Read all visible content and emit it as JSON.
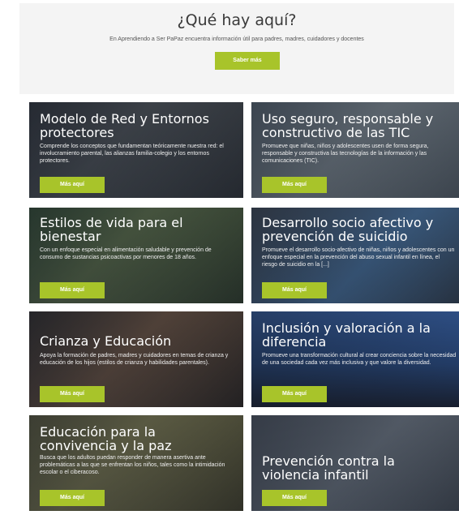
{
  "header": {
    "title": "¿Qué hay aquí?",
    "subtitle": "En Aprendiendo a Ser PaPaz encuentra información útil para padres, madres, cuidadores y docentes",
    "cta_label": "Saber más"
  },
  "cards": [
    {
      "title": "Modelo de Red y Entornos protectores",
      "description": "Comprende los conceptos que fundamentan teóricamente nuestra red: el involucramiento parental, las alianzas familia-colegio y los entornos protectores.",
      "button": "Más aquí"
    },
    {
      "title": "Uso seguro, responsable y constructivo de las TIC",
      "description": "Promueve que niñas, niños y adolescentes usen de forma segura, responsable y constructiva las tecnologías de la información y las comunicaciones (TIC).",
      "button": "Más aquí"
    },
    {
      "title": "Estilos de vida para el bienestar",
      "description": "Con un enfoque especial en alimentación saludable y prevención de consumo de sustancias psicoactivas por menores de 18 años.",
      "button": "Más aquí"
    },
    {
      "title": "Desarrollo socio afectivo y prevención de suicidio",
      "description": "Promueve el desarrollo socio-afectivo de niñas, niños y adolescentes con un enfoque especial en la prevención del abuso sexual infantil en línea, el riesgo de suicidio en la [...]",
      "button": "Más aquí"
    },
    {
      "title": "Crianza y Educación",
      "description": "Apoya la formación de padres, madres y cuidadores en temas de crianza y educación de los hijos (estilos de crianza y habilidades parentales).",
      "button": "Más aquí"
    },
    {
      "title": "Inclusión y valoración a la diferencia",
      "description": "Promueve una transformación cultural al crear conciencia sobre la necesidad de una sociedad cada vez más inclusiva y que valore la diversidad.",
      "button": "Más aquí"
    },
    {
      "title": "Educación para la convivencia y la paz",
      "description": "Busca que los adultos puedan responder de manera asertiva ante problemáticas a las que se enfrentan los niños, tales como la intimidación escolar o el ciberacoso.",
      "button": "Más aquí"
    },
    {
      "title": "Prevención contra la violencia infantil",
      "description": "",
      "button": "Más aquí"
    }
  ]
}
